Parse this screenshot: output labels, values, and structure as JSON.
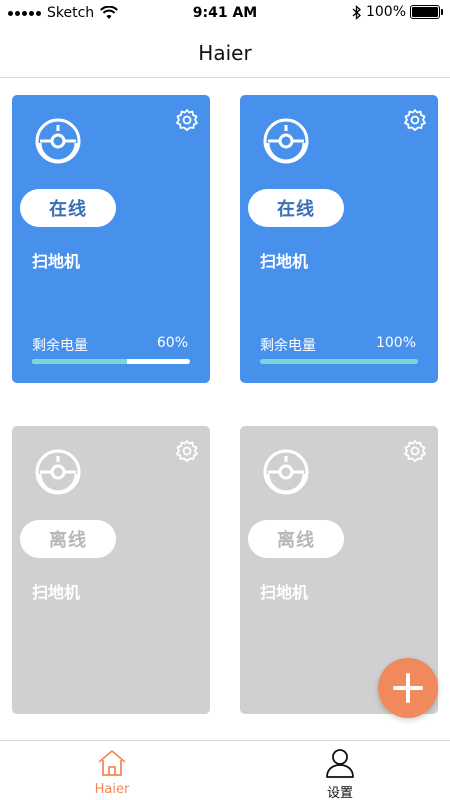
{
  "status_bar": {
    "carrier": "Sketch",
    "time": "9:41 AM",
    "battery": "100%",
    "icons": [
      "signal-dots",
      "wifi-icon",
      "bluetooth-icon",
      "battery-icon"
    ]
  },
  "nav": {
    "title": "Haier"
  },
  "devices": [
    {
      "status": "在线",
      "name": "扫地机",
      "battery_label": "剩余电量",
      "battery_text": "60%",
      "battery_fraction": 0.6,
      "online": true
    },
    {
      "status": "在线",
      "name": "扫地机",
      "battery_label": "剩余电量",
      "battery_text": "100%",
      "battery_fraction": 1.0,
      "online": true
    },
    {
      "status": "离线",
      "name": "扫地机",
      "online": false
    },
    {
      "status": "离线",
      "name": "扫地机",
      "online": false
    }
  ],
  "fab": {
    "icon": "plus-icon"
  },
  "tabs": [
    {
      "label": "Haier",
      "icon": "home-icon",
      "active": true
    },
    {
      "label": "设置",
      "icon": "user-icon",
      "active": false
    }
  ],
  "colors": {
    "online_card": "#4791ed",
    "offline_card": "#d0d0d3",
    "accent": "#f08a5d",
    "progress": "#7ad7d6"
  }
}
